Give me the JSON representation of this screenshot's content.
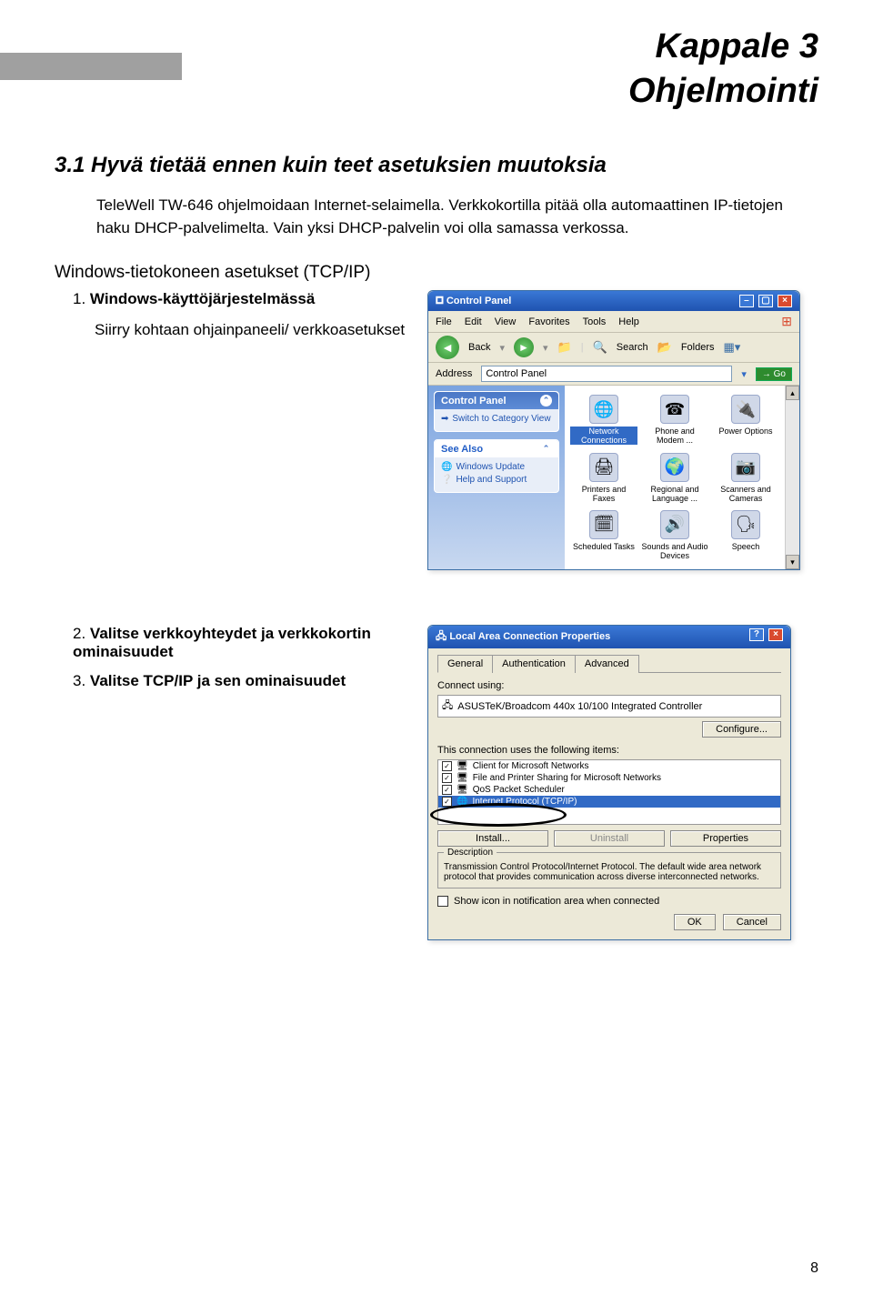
{
  "header": {
    "chapter": "Kappale 3",
    "subtitle": "Ohjelmointi"
  },
  "section": {
    "heading": "3.1 Hyvä tietää ennen kuin teet asetuksien muutoksia",
    "paragraph": "TeleWell TW-646 ohjelmoidaan Internet-selaimella. Verkkokortilla pitää olla automaattinen IP-tietojen haku DHCP-palvelimelta. Vain yksi DHCP-palvelin voi olla samassa verkossa."
  },
  "subheading": "Windows-tietokoneen asetukset (TCP/IP)",
  "step1": {
    "num": "1.",
    "bold": "Windows-käyttöjärjestelmässä",
    "sub": "Siirry kohtaan ohjainpaneeli/ verkkoasetukset"
  },
  "step2": {
    "num": "2.",
    "bold": "Valitse verkkoyhteydet ja verkkokortin ominaisuudet"
  },
  "step3": {
    "num": "3.",
    "bold": "Valitse TCP/IP ja sen ominaisuudet"
  },
  "cp": {
    "title": "Control Panel",
    "menu": [
      "File",
      "Edit",
      "View",
      "Favorites",
      "Tools",
      "Help"
    ],
    "toolbar": {
      "back": "Back",
      "search": "Search",
      "folders": "Folders"
    },
    "address_label": "Address",
    "address_value": "Control Panel",
    "go": "Go",
    "side": {
      "box1": {
        "title": "Control Panel",
        "link": "Switch to Category View"
      },
      "box2": {
        "title": "See Also",
        "links": [
          "Windows Update",
          "Help and Support"
        ]
      }
    },
    "icons": [
      {
        "label": "Network Connections",
        "glyph": "🌐",
        "selected": true
      },
      {
        "label": "Phone and Modem ...",
        "glyph": "☎"
      },
      {
        "label": "Power Options",
        "glyph": "🔌"
      },
      {
        "label": "Printers and Faxes",
        "glyph": "🖨"
      },
      {
        "label": "Regional and Language ...",
        "glyph": "🌍"
      },
      {
        "label": "Scanners and Cameras",
        "glyph": "📷"
      },
      {
        "label": "Scheduled Tasks",
        "glyph": "🗓"
      },
      {
        "label": "Sounds and Audio Devices",
        "glyph": "🔊"
      },
      {
        "label": "Speech",
        "glyph": "🗣"
      }
    ]
  },
  "prop": {
    "title": "Local Area Connection Properties",
    "tabs": [
      "General",
      "Authentication",
      "Advanced"
    ],
    "connect_using": "Connect using:",
    "adapter": "ASUSTeK/Broadcom 440x 10/100 Integrated Controller",
    "configure": "Configure...",
    "items_label": "This connection uses the following items:",
    "items": [
      "Client for Microsoft Networks",
      "File and Printer Sharing for Microsoft Networks",
      "QoS Packet Scheduler",
      "Internet Protocol (TCP/IP)"
    ],
    "install": "Install...",
    "uninstall": "Uninstall",
    "properties": "Properties",
    "desc_label": "Description",
    "desc": "Transmission Control Protocol/Internet Protocol. The default wide area network protocol that provides communication across diverse interconnected networks.",
    "show_icon": "Show icon in notification area when connected",
    "ok": "OK",
    "cancel": "Cancel"
  },
  "page_number": "8"
}
